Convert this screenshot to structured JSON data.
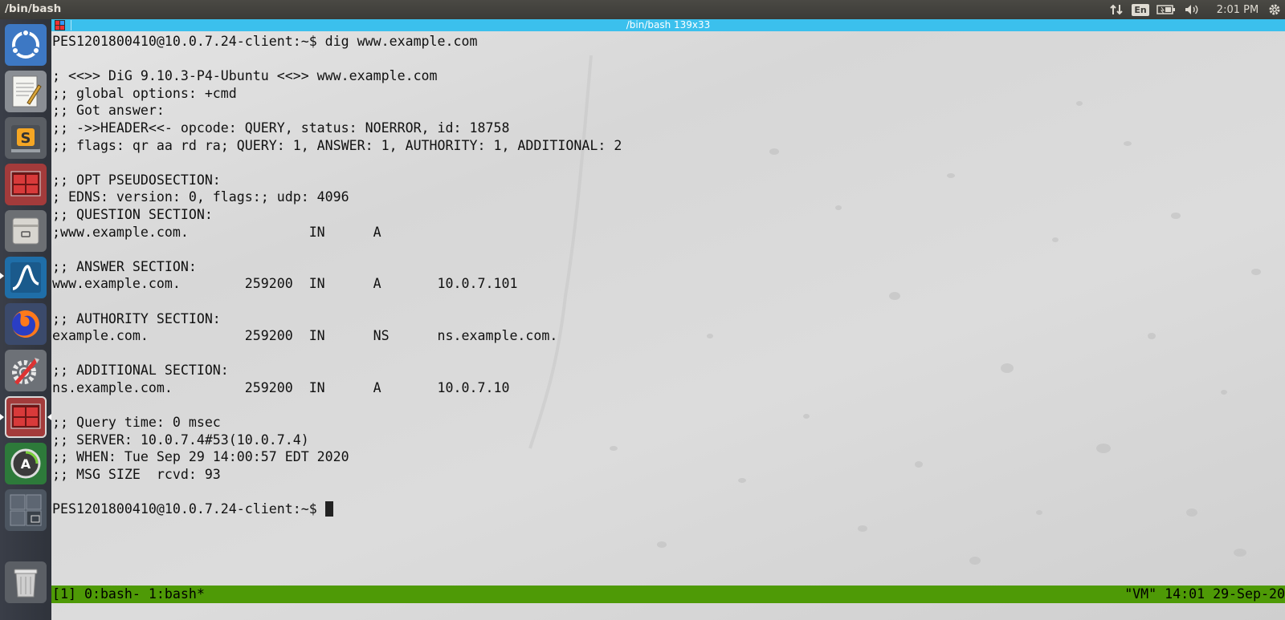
{
  "top_panel": {
    "title": "/bin/bash",
    "keyboard_layout": "En",
    "clock": "2:01 PM"
  },
  "launcher": {
    "items": [
      {
        "icon": "ubuntu-dash-icon"
      },
      {
        "icon": "text-editor-icon"
      },
      {
        "icon": "sublime-text-icon"
      },
      {
        "icon": "terminal-icon"
      },
      {
        "icon": "file-manager-icon"
      },
      {
        "icon": "wireshark-icon"
      },
      {
        "icon": "firefox-icon"
      },
      {
        "icon": "system-settings-icon"
      },
      {
        "icon": "terminal-icon"
      },
      {
        "icon": "software-updater-icon"
      },
      {
        "icon": "workspace-switcher-icon"
      },
      {
        "icon": "trash-icon"
      }
    ]
  },
  "terminal": {
    "title": "/bin/bash 139x33",
    "lines": [
      "PES1201800410@10.0.7.24-client:~$ dig www.example.com",
      "",
      "; <<>> DiG 9.10.3-P4-Ubuntu <<>> www.example.com",
      ";; global options: +cmd",
      ";; Got answer:",
      ";; ->>HEADER<<- opcode: QUERY, status: NOERROR, id: 18758",
      ";; flags: qr aa rd ra; QUERY: 1, ANSWER: 1, AUTHORITY: 1, ADDITIONAL: 2",
      "",
      ";; OPT PSEUDOSECTION:",
      "; EDNS: version: 0, flags:; udp: 4096",
      ";; QUESTION SECTION:",
      ";www.example.com.               IN      A",
      "",
      ";; ANSWER SECTION:",
      "www.example.com.        259200  IN      A       10.0.7.101",
      "",
      ";; AUTHORITY SECTION:",
      "example.com.            259200  IN      NS      ns.example.com.",
      "",
      ";; ADDITIONAL SECTION:",
      "ns.example.com.         259200  IN      A       10.0.7.10",
      "",
      ";; Query time: 0 msec",
      ";; SERVER: 10.0.7.4#53(10.0.7.4)",
      ";; WHEN: Tue Sep 29 14:00:57 EDT 2020",
      ";; MSG SIZE  rcvd: 93",
      ""
    ],
    "prompt": "PES1201800410@10.0.7.24-client:~$ ",
    "status_left": "[1] 0:bash- 1:bash*",
    "status_right": "\"VM\" 14:01 29-Sep-20"
  },
  "colors": {
    "panel_bg": "#3c3b37",
    "launcher_bg": "#31353d",
    "terminal_title_bg": "#3bc0ed",
    "tmux_status_bg": "#4e9a06"
  }
}
